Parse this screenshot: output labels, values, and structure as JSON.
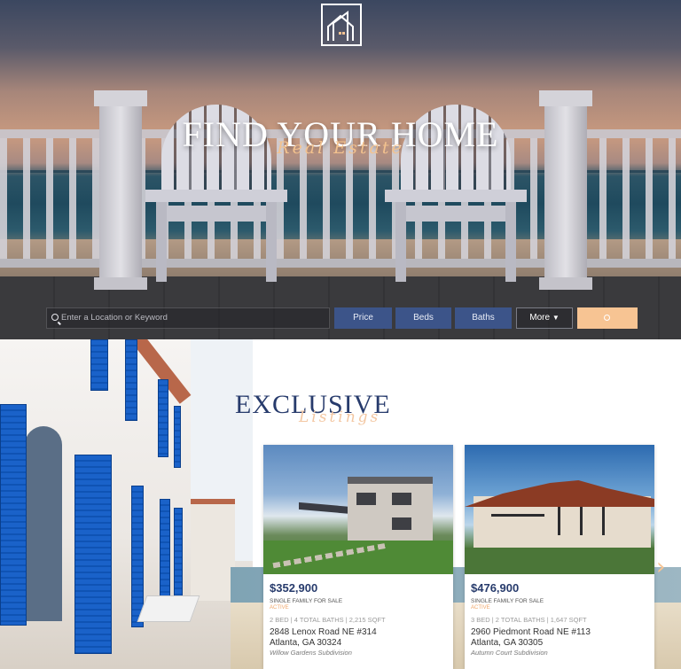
{
  "hero": {
    "title": "FIND YOUR HOME",
    "subtitle": "Real Estate"
  },
  "search": {
    "placeholder": "Enter a Location or Keyword",
    "filters": [
      "Price",
      "Beds",
      "Baths"
    ],
    "more_label": "More",
    "accent": "#f7c493",
    "filter_color": "#3c5489"
  },
  "section": {
    "title": "EXCLUSIVE",
    "subtitle": "Listings"
  },
  "listings": [
    {
      "price": "$352,900",
      "type": "SINGLE FAMILY FOR SALE",
      "status": "ACTIVE",
      "specs": "2 BED  |  4 TOTAL BATHS  |  2,215 SQFT",
      "address1": "2848 Lenox Road NE #314",
      "address2": "Atlanta, GA 30324",
      "subdivision": "Willow Gardens Subdivision"
    },
    {
      "price": "$476,900",
      "type": "SINGLE FAMILY FOR SALE",
      "status": "ACTIVE",
      "specs": "3 BED  |  2 TOTAL BATHS  |  1,647 SQFT",
      "address1": "2960 Piedmont Road NE #113",
      "address2": "Atlanta, GA 30305",
      "subdivision": "Autumn Court Subdivision"
    }
  ],
  "icons": {
    "logo": "house-logo-icon",
    "search": "search-icon",
    "more": "chevron-down-icon",
    "next": "chevron-right-icon"
  },
  "colors": {
    "brand_navy": "#273b6c",
    "accent_peach": "#f7c493"
  }
}
